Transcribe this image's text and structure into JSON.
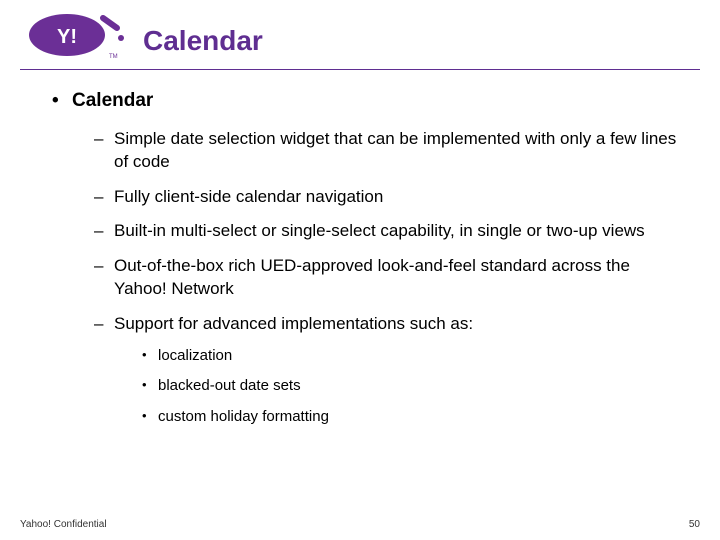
{
  "header": {
    "title": "Calendar",
    "logo_alt": "Yahoo! logo"
  },
  "content": {
    "bullet1": {
      "title": "Calendar",
      "items": [
        "Simple date selection widget that can be implemented with only a few lines of code",
        "Fully client-side calendar navigation",
        "Built-in multi-select or single-select capability, in single or two-up views",
        "Out-of-the-box rich UED-approved look-and-feel standard across the Yahoo! Network",
        "Support for advanced implementations such as:"
      ],
      "subitems": [
        "localization",
        "blacked-out date sets",
        "custom holiday formatting"
      ]
    }
  },
  "footer": {
    "left": "Yahoo! Confidential",
    "right": "50"
  },
  "brand": {
    "purple": "#5f2e91"
  }
}
